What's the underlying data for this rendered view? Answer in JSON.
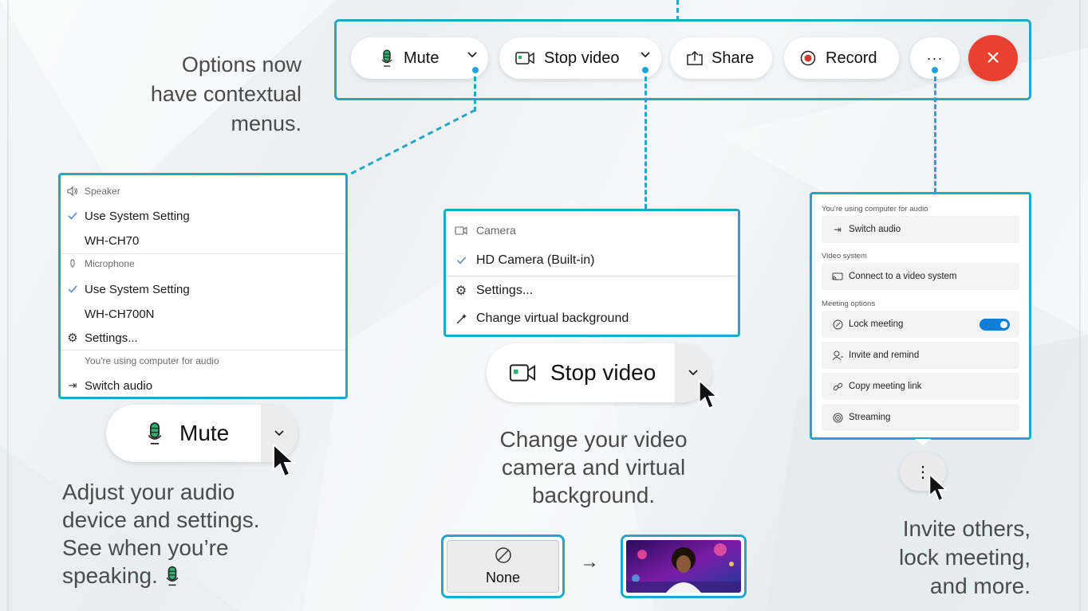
{
  "toolbar": {
    "mute_label": "Mute",
    "stop_video_label": "Stop video",
    "share_label": "Share",
    "record_label": "Record",
    "more_label": "···",
    "end_label": "×"
  },
  "callouts": {
    "options_line1": "Options now",
    "options_line2": "have contextual",
    "options_line3": "menus.",
    "audio_line1": "Adjust your audio",
    "audio_line2": "device and settings.",
    "audio_line3": "See when you’re",
    "audio_line4": "speaking.",
    "video_line1": "Change your video",
    "video_line2": "camera and virtual",
    "video_line3": "background.",
    "more_line1": "Invite others,",
    "more_line2": "lock meeting,",
    "more_line3": "and more."
  },
  "audio_menu": {
    "speaker_header": "Speaker",
    "speaker_system": "Use System Setting",
    "speaker_device": "WH-CH70",
    "microphone_header": "Microphone",
    "mic_system": "Use System Setting",
    "mic_device": "WH-CH700N",
    "settings": "Settings...",
    "computer_audio_note": "You're using computer for audio",
    "switch_audio": "Switch audio"
  },
  "video_menu": {
    "camera_header": "Camera",
    "camera_device": "HD Camera (Built-in)",
    "settings": "Settings...",
    "change_background": "Change virtual background"
  },
  "more_menu": {
    "audio_header": "You're using computer for audio",
    "switch_audio": "Switch audio",
    "video_system_header": "Video system",
    "connect_video_system": "Connect to a video system",
    "meeting_options_header": "Meeting options",
    "lock_meeting": "Lock meeting",
    "lock_meeting_enabled": true,
    "invite_remind": "Invite and remind",
    "copy_link": "Copy meeting link",
    "streaming": "Streaming"
  },
  "large_buttons": {
    "mute_label": "Mute",
    "stop_video_label": "Stop video",
    "more_label": "⋮"
  },
  "background_demo": {
    "none_label": "None",
    "arrow": "→"
  },
  "colors": {
    "accent": "#21a8c8",
    "dot": "#1ba4d8",
    "end_button": "#e8412f",
    "mic_green": "#2eae6f",
    "record_red": "#d33a2c",
    "toggle_on": "#0d7fd8"
  },
  "icons": [
    "microphone-icon",
    "camera-icon",
    "share-icon",
    "record-icon",
    "more-icon",
    "close-icon",
    "chevron-down-icon",
    "speaker-icon",
    "check-icon",
    "gear-icon",
    "switch-audio-icon",
    "connect-icon",
    "lock-icon",
    "person-icon",
    "link-icon",
    "streaming-icon",
    "wand-icon",
    "cursor-icon",
    "no-background-icon"
  ]
}
